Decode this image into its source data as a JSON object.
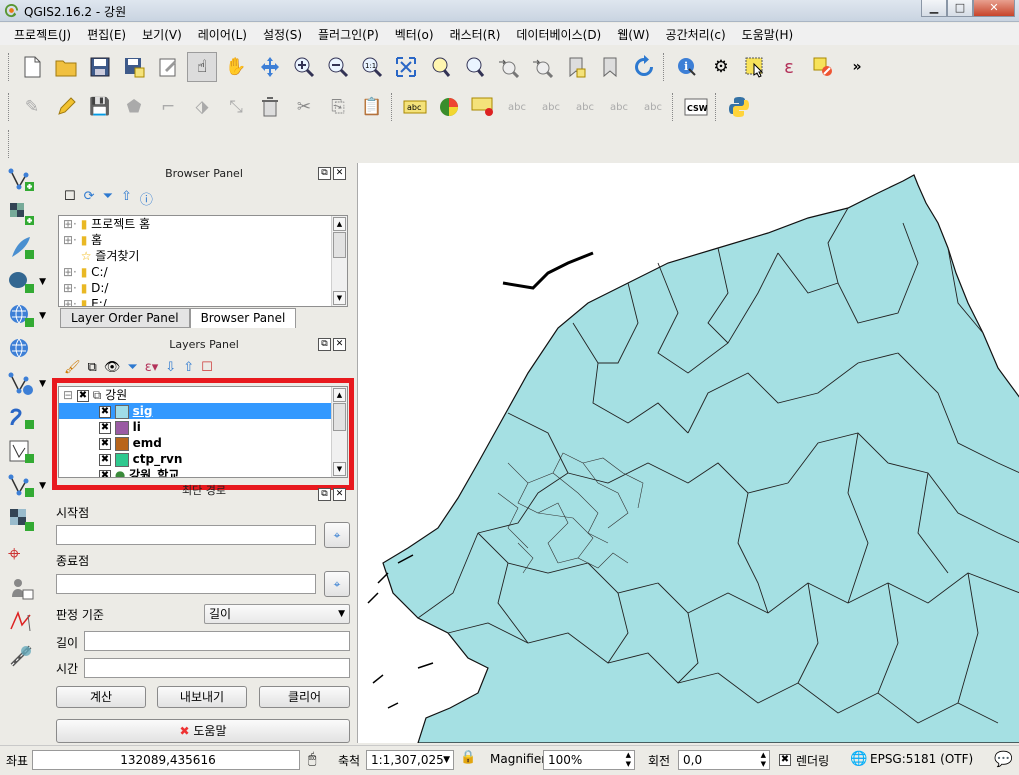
{
  "window": {
    "title": "QGIS2.16.2 - 강원",
    "minimize": "▁",
    "maximize": "□",
    "close": "✕"
  },
  "menu": [
    "프로젝트(J)",
    "편집(E)",
    "보기(V)",
    "레이어(L)",
    "설정(S)",
    "플러그인(P)",
    "벡터(o)",
    "래스터(R)",
    "데이터베이스(D)",
    "웹(W)",
    "공간처리(c)",
    "도움말(H)"
  ],
  "browser_panel": {
    "title": "Browser Panel",
    "items": [
      "프로젝트 홈",
      "홈",
      "즐겨찾기",
      "C:/",
      "D:/",
      "E:/"
    ],
    "tabs": [
      "Layer Order Panel",
      "Browser Panel"
    ]
  },
  "layers_panel": {
    "title": "Layers Panel",
    "group": "강원",
    "layers": [
      {
        "name": "sig",
        "color": "#a0dce8",
        "selected": true
      },
      {
        "name": "li",
        "color": "#9a5ba3",
        "selected": false
      },
      {
        "name": "emd",
        "color": "#b8651b",
        "selected": false
      },
      {
        "name": "ctp_rvn",
        "color": "#2fc98f",
        "selected": false
      },
      {
        "name": "강원_학교",
        "color": "#3a8a3a",
        "selected": false
      }
    ]
  },
  "route_panel": {
    "title": "최단 경로",
    "start_label": "시작점",
    "end_label": "종료점",
    "criterion_label": "판정 기준",
    "criterion_value": "길이",
    "length_label": "길이",
    "time_label": "시간",
    "calculate": "계산",
    "export": "내보내기",
    "clear": "클리어",
    "help": "도움말"
  },
  "status": {
    "coord_label": "좌표",
    "coord_value": "132089,435616",
    "scale_label": "축척",
    "scale_value": "1:1,307,025",
    "magnifier_label": "Magnifier",
    "magnifier_value": "100%",
    "rotation_label": "회전",
    "rotation_value": "0,0",
    "render_label": "렌더링",
    "crs": "EPSG:5181 (OTF)"
  },
  "toolbar_text": {
    "abc": "abc",
    "csw": "CSW"
  },
  "colors": {
    "map_fill": "#a5e0e3",
    "highlight": "#e8191e",
    "selection": "#3399ff"
  }
}
